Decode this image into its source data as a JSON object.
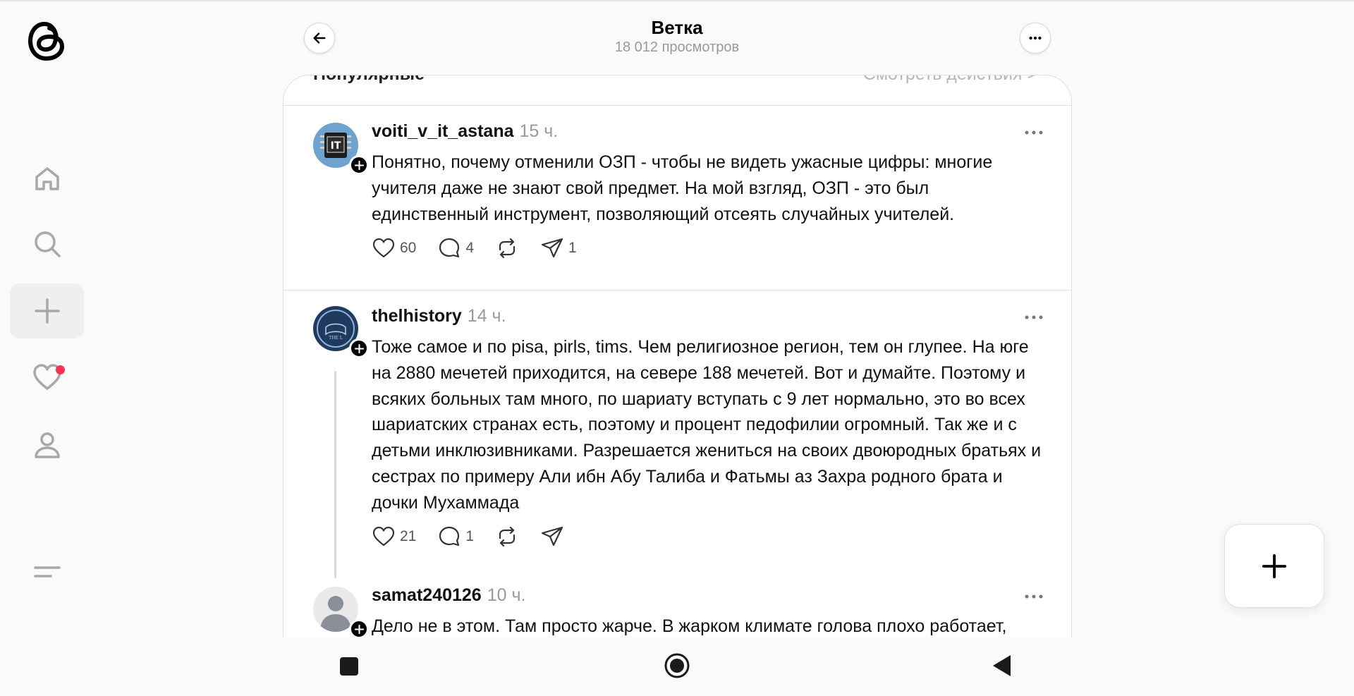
{
  "header": {
    "title": "Ветка",
    "subtitle": "18 012 просмотров"
  },
  "sort_bar": {
    "left_label": "Популярные",
    "right_label": "Смотреть действия >"
  },
  "posts": [
    {
      "username": "voiti_v_it_astana",
      "time": "15 ч.",
      "text": "Понятно, почему отменили ОЗП - чтобы не видеть ужасные цифры: многие учителя даже не знают свой предмет. На мой взгляд, ОЗП - это был единственный инструмент, позволяющий отсеять случайных учителей.",
      "likes": "60",
      "replies": "4",
      "shares": "1"
    },
    {
      "username": "thelhistory",
      "time": "14 ч.",
      "text": "Тоже самое и по pisa, pirls, tims. Чем религиозное регион, тем он глупее. На юге на 2880 мечетей приходится, на севере 188 мечетей. Вот и думайте. Поэтому и всяких больных там много, по шариату вступать с 9 лет нормально, это во всех шариатских странах есть, поэтому и процент педофилии огромный. Так же и с детьми инклюзивниками. Разрешается жениться на своих двоюродных братьях и сестрах по примеру Али ибн Абу Талиба и Фатьмы аз Захра родного брата и дочки Мухаммада",
      "likes": "21",
      "replies": "1"
    },
    {
      "username": "samat240126",
      "time": "10 ч.",
      "text": "Дело не в этом. Там просто жарче. В жарком климате голова плохо работает,"
    }
  ],
  "colors": {
    "notification_dot": "#ff2e55",
    "muted_text": "#9a9a9a"
  }
}
